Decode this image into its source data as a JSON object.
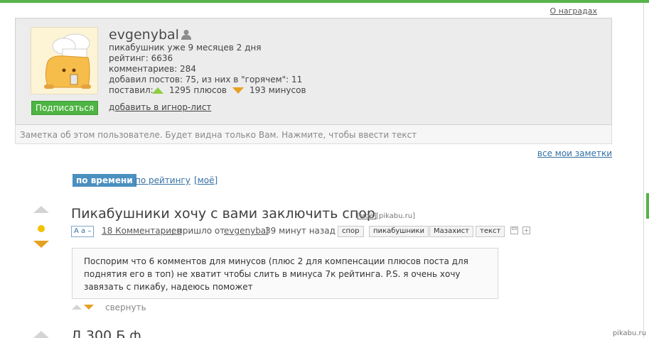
{
  "awards_link": "О наградах",
  "profile": {
    "username": "evgenybal",
    "info": {
      "age": "пикабушник уже 9 месяцев 2 дня",
      "rating": "рейтинг: 6636",
      "comments": "комментариев: 284",
      "posts": "добавил постов: 75, из них в \"горячем\": 11",
      "gave_label": "поставил:",
      "pluses": "1295 плюсов",
      "minuses": "193 минусов"
    },
    "subscribe_label": "Подписаться",
    "ignore_label": "добавить в игнор-лист"
  },
  "note_placeholder": "Заметка об этом пользователе. Будет видна только Вам. Нажмите, чтобы ввести текст",
  "all_notes_link": "все мои заметки",
  "sort": {
    "active": "по времени",
    "by_rating": "по рейтингу",
    "mine": "[моё]"
  },
  "post": {
    "title": "Пикабушники хочу с вами заключить спор",
    "mine_tag": "[моё]",
    "source": "[pikabu.ru]",
    "font_toggle": "A a –",
    "comments_link": "18 Комментариев",
    "arrived_from": "; пришло от",
    "author": "evgenybal",
    "time": "39 минут назад",
    "tags": [
      "спор",
      "пикабушники",
      "Мазахист",
      "текст"
    ],
    "body": "Поспорим что 6 комментов для минусов (плюс 2 для компенсации плюсов поста для поднятия его в топ) не хватит чтобы слить в минуса 7к рейтинга. P.S. я очень хочу завязать с пикабу, надеюсь поможет",
    "collapse_label": "свернуть"
  },
  "next_post_partial": "Д                    300 Б                  ф",
  "watermark": "pikabu.ru",
  "colors": {
    "accent_green": "#56b44a",
    "link_blue": "#3470a4",
    "plus_green": "#8ccf3e",
    "minus_orange": "#e6a020",
    "rating_dot": "#f2c200"
  }
}
